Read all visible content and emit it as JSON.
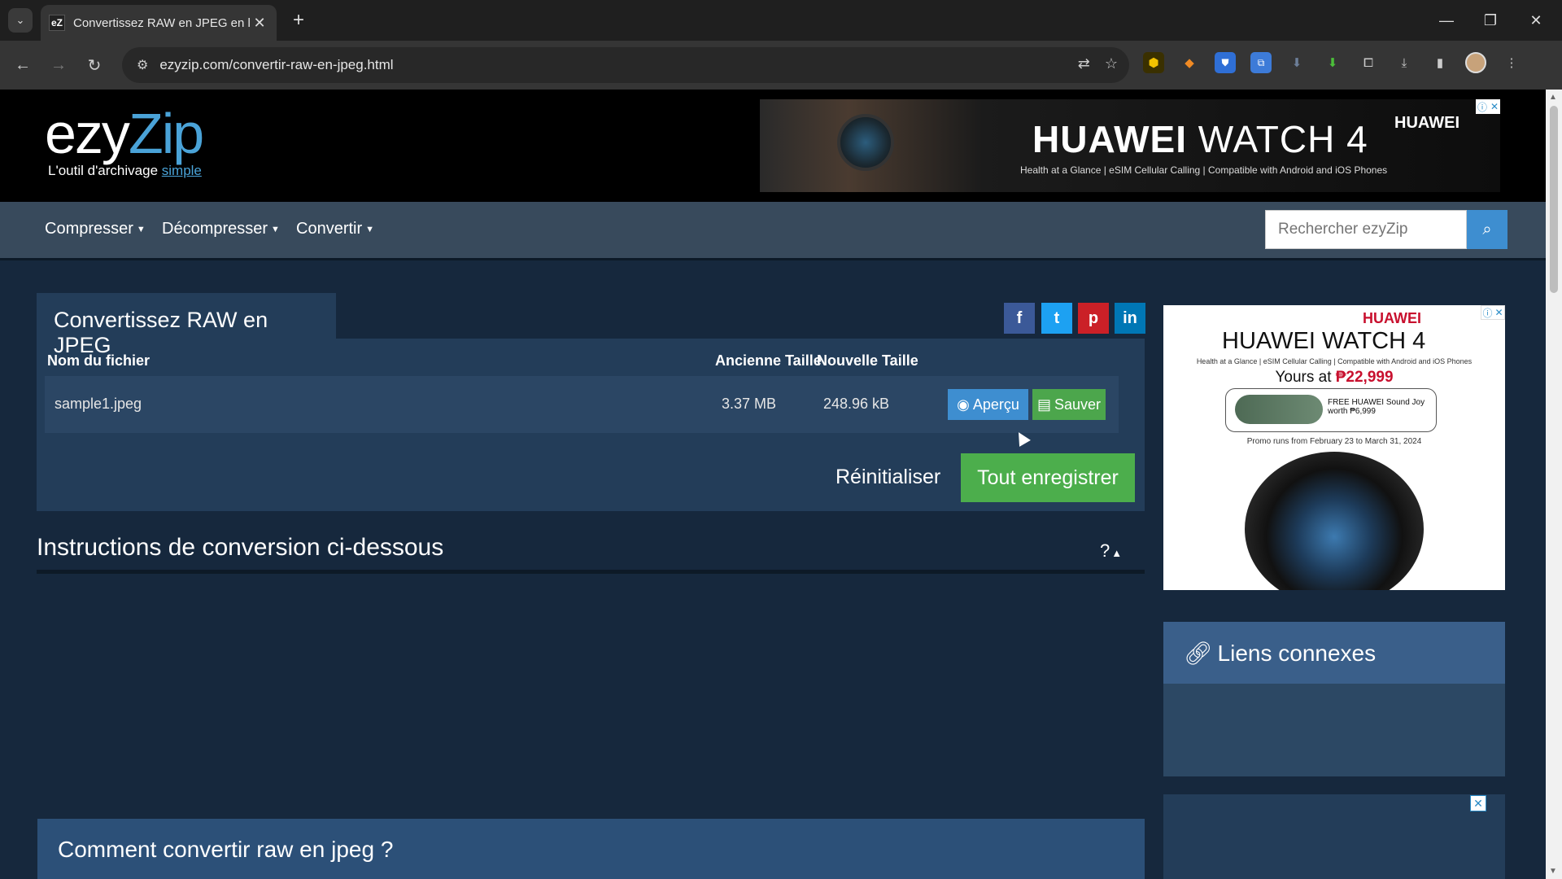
{
  "browser": {
    "tab_title": "Convertissez RAW en JPEG en li",
    "tab_favicon": "eZ",
    "url": "ezyzip.com/convertir-raw-en-jpeg.html"
  },
  "site": {
    "logo_ezy": "ezy",
    "logo_zip": "Zip",
    "tagline": "L'outil d'archivage",
    "tagline_accent": "simple"
  },
  "ad_top": {
    "title_bold": "HUAWEI",
    "title_rest": "WATCH 4",
    "subtitle": "Health at a Glance | eSIM Cellular Calling | Compatible with Android and iOS Phones",
    "brand": "HUAWEI"
  },
  "nav": {
    "items": [
      "Compresser",
      "Décompresser",
      "Convertir"
    ],
    "search_placeholder": "Rechercher ezyZip"
  },
  "converter": {
    "title": "Convertissez RAW en JPEG",
    "columns": [
      "Nom du fichier",
      "Ancienne Taille",
      "Nouvelle Taille"
    ],
    "file": {
      "name": "sample1.jpeg",
      "old_size": "3.37 MB",
      "new_size": "248.96 kB"
    },
    "preview_label": "Aperçu",
    "save_label": "Sauver",
    "reset_label": "Réinitialiser",
    "save_all_label": "Tout enregistrer"
  },
  "instructions": {
    "title": "Instructions de conversion ci-dessous",
    "toggle": "?"
  },
  "howto": {
    "title": "Comment convertir raw en jpeg ?"
  },
  "ad_side": {
    "brand": "HUAWEI",
    "title": "HUAWEI WATCH 4",
    "subtitle": "Health at a Glance | eSIM Cellular Calling | Compatible with Android and iOS Phones",
    "price_prefix": "Yours at",
    "price": "₱22,999",
    "offer": "FREE HUAWEI Sound Joy worth ₱6,999",
    "promo": "Promo runs from February 23 to March 31, 2024"
  },
  "related": {
    "title": "Liens connexes"
  },
  "colors": {
    "page_bg": "#16283d",
    "panel_bg": "#233d59",
    "accent_blue": "#3e8ed0",
    "accent_green": "#4cae4c"
  }
}
